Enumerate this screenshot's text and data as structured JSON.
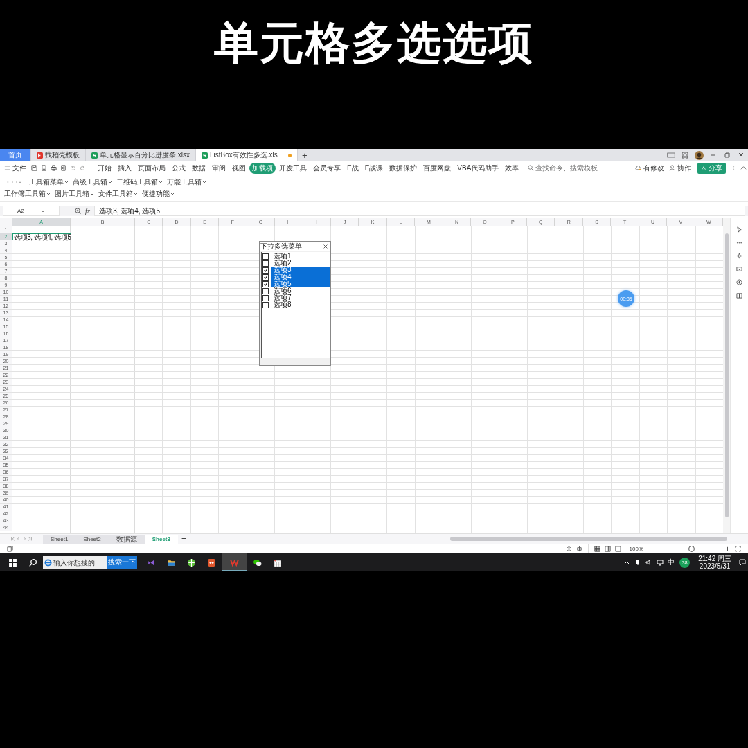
{
  "title": "单元格多选选项",
  "tabs": [
    {
      "label": "首页",
      "kind": "home",
      "selected": false,
      "modified": false
    },
    {
      "label": "找稻壳模板",
      "kind": "template",
      "selected": false,
      "modified": false
    },
    {
      "label": "单元格显示百分比进度条.xlsx",
      "kind": "sheet",
      "selected": false,
      "modified": false
    },
    {
      "label": "ListBox有效性多选.xls",
      "kind": "sheet",
      "selected": true,
      "modified": true
    }
  ],
  "new_tab": "+",
  "file_menu": "文件",
  "ribbon_tabs": [
    {
      "label": "开始",
      "selected": false
    },
    {
      "label": "插入",
      "selected": false
    },
    {
      "label": "页面布局",
      "selected": false
    },
    {
      "label": "公式",
      "selected": false
    },
    {
      "label": "数据",
      "selected": false
    },
    {
      "label": "审阅",
      "selected": false
    },
    {
      "label": "视图",
      "selected": false
    },
    {
      "label": "加载项",
      "selected": true
    },
    {
      "label": "开发工具",
      "selected": false
    },
    {
      "label": "会员专享",
      "selected": false
    },
    {
      "label": "E战",
      "selected": false
    },
    {
      "label": "E战课",
      "selected": false
    },
    {
      "label": "数据保护",
      "selected": false
    },
    {
      "label": "百度网盘",
      "selected": false
    },
    {
      "label": "VBA代码助手",
      "selected": false
    },
    {
      "label": "效率",
      "selected": false
    }
  ],
  "search": {
    "placeholder": "查找命令、搜索模板"
  },
  "right_actions": {
    "changes": "有修改",
    "collab": "协作",
    "share": "分享"
  },
  "toolbar_rows": [
    [
      "工具箱菜单",
      "高级工具箱",
      "二维码工具箱",
      "万能工具箱"
    ],
    [
      "工作簿工具箱",
      "图片工具箱",
      "文件工具箱",
      "便捷功能"
    ]
  ],
  "formula_bar": {
    "name_box": "A2",
    "fx": "fx",
    "value": "选项3, 选项4, 选项5"
  },
  "grid": {
    "columns": [
      {
        "label": "A",
        "selected": true
      },
      {
        "label": "B",
        "selected": false
      },
      {
        "label": "C",
        "selected": false
      },
      {
        "label": "D",
        "selected": false
      },
      {
        "label": "E",
        "selected": false
      },
      {
        "label": "F",
        "selected": false
      },
      {
        "label": "G",
        "selected": false
      },
      {
        "label": "H",
        "selected": false
      },
      {
        "label": "I",
        "selected": false
      },
      {
        "label": "J",
        "selected": false
      },
      {
        "label": "K",
        "selected": false
      },
      {
        "label": "L",
        "selected": false
      },
      {
        "label": "M",
        "selected": false
      },
      {
        "label": "N",
        "selected": false
      },
      {
        "label": "O",
        "selected": false
      },
      {
        "label": "P",
        "selected": false
      },
      {
        "label": "Q",
        "selected": false
      },
      {
        "label": "R",
        "selected": false
      },
      {
        "label": "S",
        "selected": false
      },
      {
        "label": "T",
        "selected": false
      },
      {
        "label": "U",
        "selected": false
      },
      {
        "label": "V",
        "selected": false
      },
      {
        "label": "W",
        "selected": false
      }
    ],
    "rows": [
      {
        "number": "1",
        "selected": false
      },
      {
        "number": "2",
        "selected": true,
        "cell_a": "选项3, 选项4, 选项5"
      },
      {
        "number": "3",
        "selected": false
      },
      {
        "number": "4",
        "selected": false
      },
      {
        "number": "5",
        "selected": false
      },
      {
        "number": "6",
        "selected": false
      },
      {
        "number": "7",
        "selected": false
      },
      {
        "number": "8",
        "selected": false
      },
      {
        "number": "9",
        "selected": false
      },
      {
        "number": "10",
        "selected": false
      },
      {
        "number": "11",
        "selected": false
      },
      {
        "number": "12",
        "selected": false
      },
      {
        "number": "13",
        "selected": false
      },
      {
        "number": "14",
        "selected": false
      },
      {
        "number": "15",
        "selected": false
      },
      {
        "number": "16",
        "selected": false
      },
      {
        "number": "17",
        "selected": false
      },
      {
        "number": "18",
        "selected": false
      },
      {
        "number": "19",
        "selected": false
      },
      {
        "number": "20",
        "selected": false
      },
      {
        "number": "21",
        "selected": false
      },
      {
        "number": "22",
        "selected": false
      },
      {
        "number": "23",
        "selected": false
      },
      {
        "number": "24",
        "selected": false
      },
      {
        "number": "25",
        "selected": false
      },
      {
        "number": "26",
        "selected": false
      },
      {
        "number": "27",
        "selected": false
      },
      {
        "number": "28",
        "selected": false
      },
      {
        "number": "29",
        "selected": false
      },
      {
        "number": "30",
        "selected": false
      },
      {
        "number": "31",
        "selected": false
      },
      {
        "number": "32",
        "selected": false
      },
      {
        "number": "33",
        "selected": false
      },
      {
        "number": "34",
        "selected": false
      },
      {
        "number": "35",
        "selected": false
      },
      {
        "number": "36",
        "selected": false
      },
      {
        "number": "37",
        "selected": false
      },
      {
        "number": "38",
        "selected": false
      },
      {
        "number": "39",
        "selected": false
      },
      {
        "number": "40",
        "selected": false
      },
      {
        "number": "41",
        "selected": false
      },
      {
        "number": "42",
        "selected": false
      },
      {
        "number": "43",
        "selected": false
      },
      {
        "number": "44",
        "selected": false
      }
    ]
  },
  "listbox": {
    "title": "下拉多选菜单",
    "items": [
      {
        "label": "选项1",
        "checked": false,
        "selected": false
      },
      {
        "label": "选项2",
        "checked": false,
        "selected": false
      },
      {
        "label": "选项3",
        "checked": true,
        "selected": true
      },
      {
        "label": "选项4",
        "checked": true,
        "selected": true
      },
      {
        "label": "选项5",
        "checked": true,
        "selected": true
      },
      {
        "label": "选项6",
        "checked": false,
        "selected": false
      },
      {
        "label": "选项7",
        "checked": false,
        "selected": false
      },
      {
        "label": "选项8",
        "checked": false,
        "selected": false
      }
    ]
  },
  "timer": "00:35",
  "sheet_tabs": [
    {
      "label": "Sheet1",
      "selected": false
    },
    {
      "label": "Sheet2",
      "selected": false
    },
    {
      "label": "数据源",
      "selected": false
    },
    {
      "label": "Sheet3",
      "selected": true
    }
  ],
  "add_sheet": "+",
  "status_bar": {
    "zoom": "100%",
    "zoom_slider": {
      "level": 0.5
    }
  },
  "taskbar": {
    "search_placeholder": "输入你想搜的",
    "search_button": "搜索一下",
    "ime": "中",
    "badge": "38",
    "time": "21:42 周三",
    "date": "2023/5/31"
  }
}
